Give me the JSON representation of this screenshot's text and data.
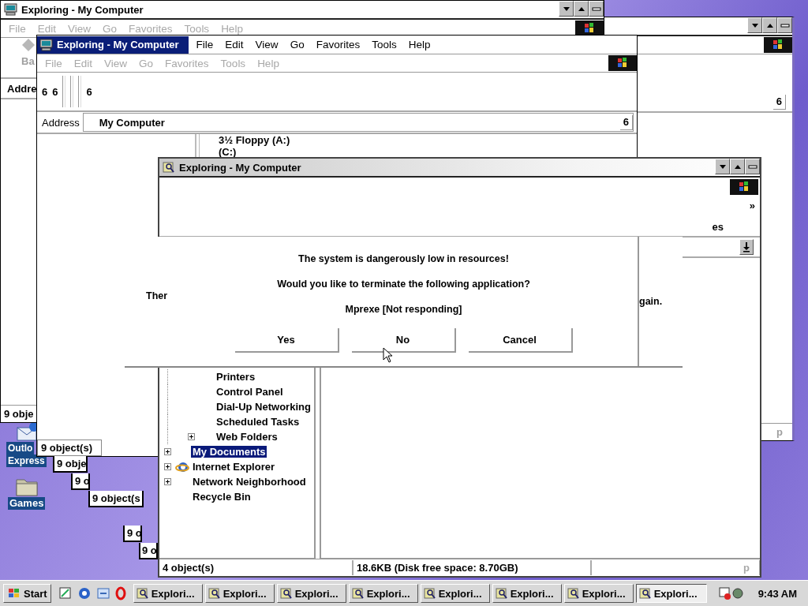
{
  "desktop_icons": [
    {
      "kind": "mail",
      "lines": [
        "Outlo",
        "Express"
      ],
      "selected": true
    },
    {
      "kind": "folder",
      "lines": [
        "Games"
      ],
      "selected": true
    }
  ],
  "right_window": {
    "address_dropdown": "6",
    "status": "p"
  },
  "back_window": {
    "title": "Exploring - My Computer",
    "menu": [
      {
        "label": "File",
        "disabled": true
      },
      {
        "label": "Edit",
        "disabled": true
      },
      {
        "label": "View",
        "disabled": true
      },
      {
        "label": "Go",
        "disabled": true
      },
      {
        "label": "Favorites",
        "disabled": true
      },
      {
        "label": "Tools",
        "disabled": true
      },
      {
        "label": "Help",
        "disabled": true
      }
    ],
    "toolbar_label": "Ba",
    "address_label": "Addre",
    "status": "9 obje"
  },
  "middle_window": {
    "title": "Exploring - My Computer",
    "active": true,
    "menu": [
      {
        "label": "File",
        "disabled": false
      },
      {
        "label": "Edit",
        "disabled": false
      },
      {
        "label": "View",
        "disabled": false
      },
      {
        "label": "Go",
        "disabled": false
      },
      {
        "label": "Favorites",
        "disabled": false
      },
      {
        "label": "Tools",
        "disabled": false
      },
      {
        "label": "Help",
        "disabled": false
      }
    ],
    "menu_2": [
      {
        "label": "File",
        "disabled": true
      },
      {
        "label": "Edit",
        "disabled": true
      },
      {
        "label": "View",
        "disabled": true
      },
      {
        "label": "Go",
        "disabled": true
      },
      {
        "label": "Favorites",
        "disabled": true
      },
      {
        "label": "Tools",
        "disabled": true
      },
      {
        "label": "Help",
        "disabled": true
      }
    ],
    "toolbar": [
      "6",
      "6",
      "6"
    ],
    "address_label": "Address",
    "address": "My Computer",
    "address_dropdown": "6",
    "drives": [
      "3½ Floppy (A:)",
      "(C:)"
    ],
    "status": "9 object(s)"
  },
  "status_fragments": [
    "9 obje",
    "9 o",
    "9 object(s",
    "9 o",
    "9 o"
  ],
  "front_window": {
    "title": "Exploring - My Computer",
    "active": false,
    "chevron": "»",
    "toolbar_label": "es",
    "tree": [
      {
        "kind": "group",
        "children": [
          {
            "label": "Printers",
            "kind": "leaf",
            "selected": false,
            "has_icon": false
          },
          {
            "label": "Control Panel",
            "kind": "leaf",
            "selected": false,
            "has_icon": false
          },
          {
            "label": "Dial-Up Networking",
            "kind": "leaf",
            "selected": false,
            "has_icon": false
          },
          {
            "label": "Scheduled Tasks",
            "kind": "leaf",
            "selected": false,
            "has_icon": false
          },
          {
            "label": "Web Folders",
            "kind": "collapsed",
            "selected": false,
            "has_icon": false
          }
        ]
      },
      {
        "label": "My Documents",
        "kind": "collapsed",
        "selected": true,
        "has_icon": false
      },
      {
        "label": "Internet Explorer",
        "kind": "collapsed",
        "selected": false,
        "has_icon": true
      },
      {
        "label": "Network Neighborhood",
        "kind": "collapsed",
        "selected": false,
        "has_icon": false
      },
      {
        "label": "Recycle Bin",
        "kind": "leaf",
        "selected": false,
        "has_icon": false
      }
    ],
    "status": [
      "4 object(s)",
      "18.6KB (Disk free space: 8.70GB)",
      "p"
    ]
  },
  "dialog": {
    "lines": [
      "The system is dangerously low in resources!",
      "Would you like to terminate the following application?",
      "Mprexe [Not responding]"
    ],
    "left_fragment": "Ther",
    "right_fragment": "gain.",
    "buttons": [
      "Yes",
      "No",
      "Cancel"
    ]
  },
  "taskbar": {
    "start": "Start",
    "tasks": [
      {
        "label": "Explori...",
        "selected": false
      },
      {
        "label": "Explori...",
        "selected": false
      },
      {
        "label": "Explori...",
        "selected": false
      },
      {
        "label": "Explori...",
        "selected": false
      },
      {
        "label": "Explori...",
        "selected": false
      },
      {
        "label": "Explori...",
        "selected": false
      },
      {
        "label": "Explori...",
        "selected": false
      },
      {
        "label": "Explori...",
        "selected": true
      }
    ],
    "clock": "9:43 AM"
  }
}
